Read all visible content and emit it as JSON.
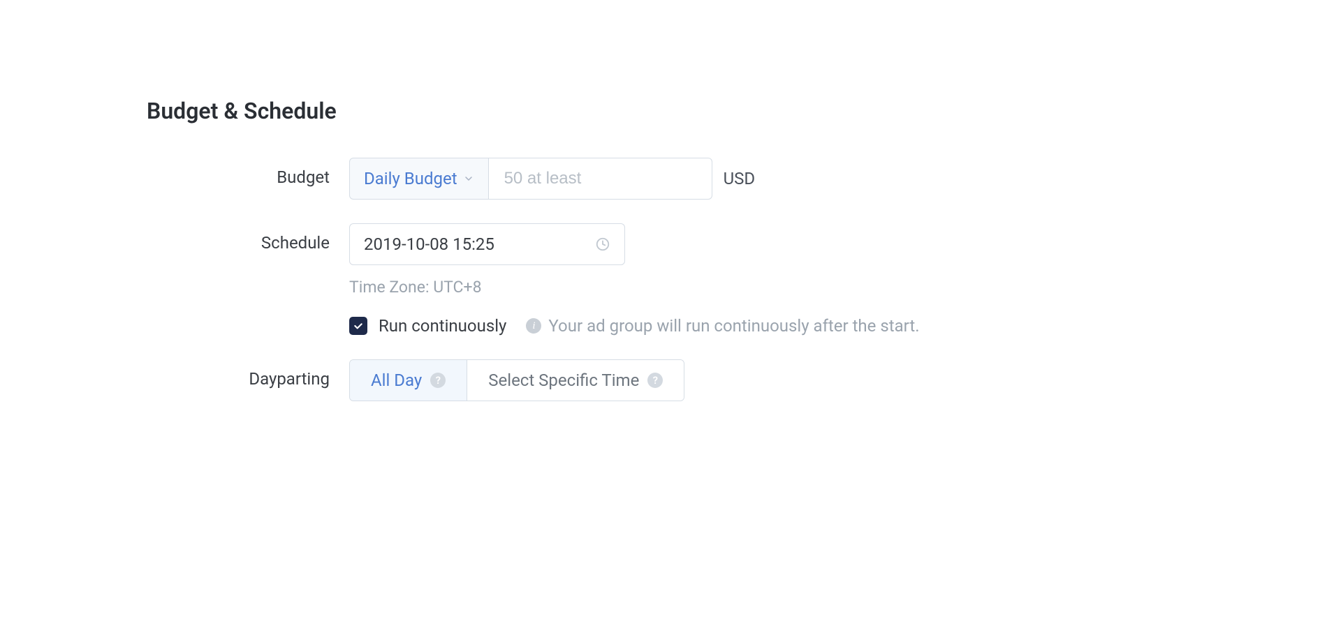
{
  "section": {
    "title": "Budget & Schedule"
  },
  "budget": {
    "label": "Budget",
    "select_value": "Daily Budget",
    "input_placeholder": "50 at least",
    "input_value": "",
    "currency": "USD"
  },
  "schedule": {
    "label": "Schedule",
    "date_value": "2019-10-08 15:25",
    "timezone_hint": "Time Zone: UTC+8",
    "run_continuously_label": "Run continuously",
    "run_continuously_checked": true,
    "run_continuously_info": "Your ad group will run continuously after the start."
  },
  "dayparting": {
    "label": "Dayparting",
    "options": [
      {
        "label": "All Day",
        "active": true
      },
      {
        "label": "Select Specific Time",
        "active": false
      }
    ]
  }
}
